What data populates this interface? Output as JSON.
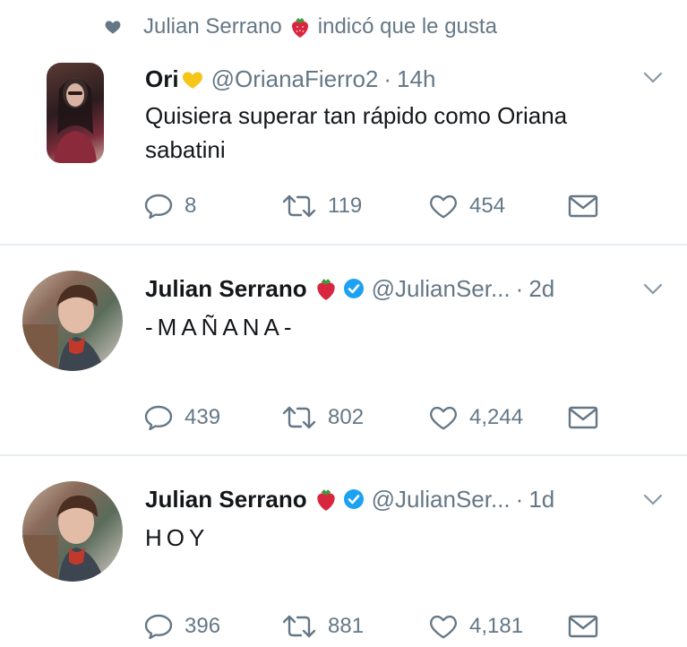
{
  "social_context": {
    "icon": "heart-icon",
    "user_name": "Julian Serrano",
    "emoji": "strawberry-emoji",
    "action_text": "indicó que le gusta"
  },
  "tweets": [
    {
      "name": "Ori",
      "name_emoji": "yellow-heart-emoji",
      "verified": false,
      "handle": "@OrianaFierro2",
      "separator": "·",
      "time": "14h",
      "text_lines": [
        "Quisiera superar tan rápido como Oriana",
        "sabatini"
      ],
      "replies": "8",
      "retweets": "119",
      "likes": "454"
    },
    {
      "name": "Julian Serrano",
      "name_emoji": "strawberry-emoji",
      "verified": true,
      "handle": "@JulianSer...",
      "separator": "·",
      "time": "2d",
      "text_lines": [
        "-MAÑANA-"
      ],
      "replies": "439",
      "retweets": "802",
      "likes": "4,244"
    },
    {
      "name": "Julian Serrano",
      "name_emoji": "strawberry-emoji",
      "verified": true,
      "handle": "@JulianSer...",
      "separator": "·",
      "time": "1d",
      "text_lines": [
        "HOY"
      ],
      "replies": "396",
      "retweets": "881",
      "likes": "4,181"
    }
  ],
  "colors": {
    "text": "#14171a",
    "secondary": "#657786",
    "divider": "#e6ecf0",
    "verified": "#1da1f2",
    "strawberry": "#d7263d",
    "yellow_heart": "#f5c518"
  }
}
